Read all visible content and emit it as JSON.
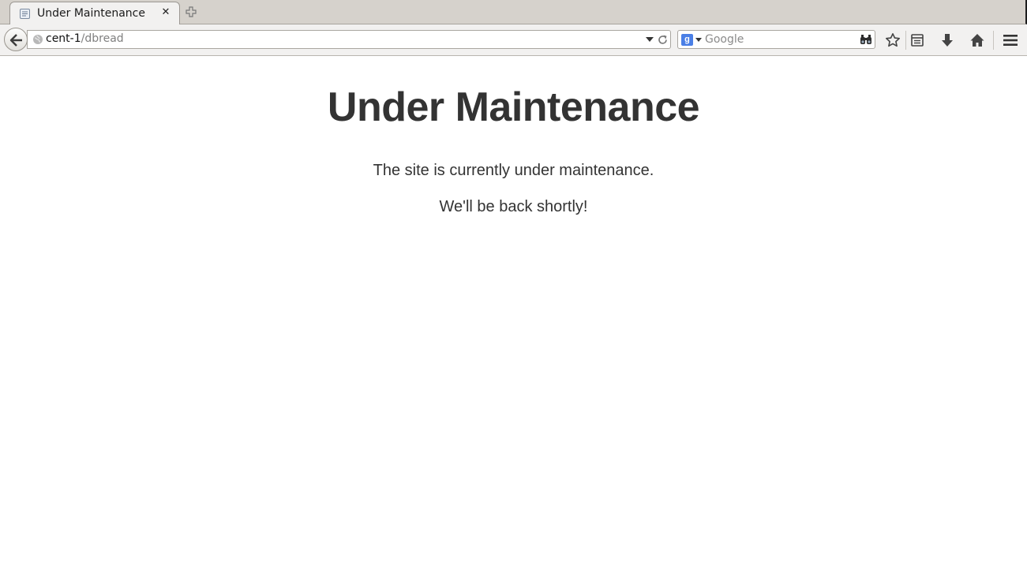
{
  "tab": {
    "title": "Under Maintenance",
    "close_glyph": "✕",
    "favicon": "page-icon"
  },
  "navbar": {
    "url_host": "cent-1",
    "url_path": "/dbread",
    "search_engine_letter": "g",
    "search_placeholder": "Google"
  },
  "page": {
    "title": "Under Maintenance",
    "message_1": "The site is currently under maintenance.",
    "message_2": "We'll be back shortly!"
  },
  "colors": {
    "text": "#333333",
    "chrome": "#f2f1f0",
    "tabstrip": "#d6d2cc",
    "search_engine": "#4a7fe6"
  },
  "icons": [
    "back-arrow-icon",
    "site-identity-icon",
    "url-dropdown-icon",
    "reload-icon",
    "search-engine-icon",
    "search-go-icon",
    "bookmark-star-icon",
    "reading-list-icon",
    "downloads-icon",
    "home-icon",
    "menu-icon",
    "new-tab-icon",
    "tab-close-icon"
  ]
}
